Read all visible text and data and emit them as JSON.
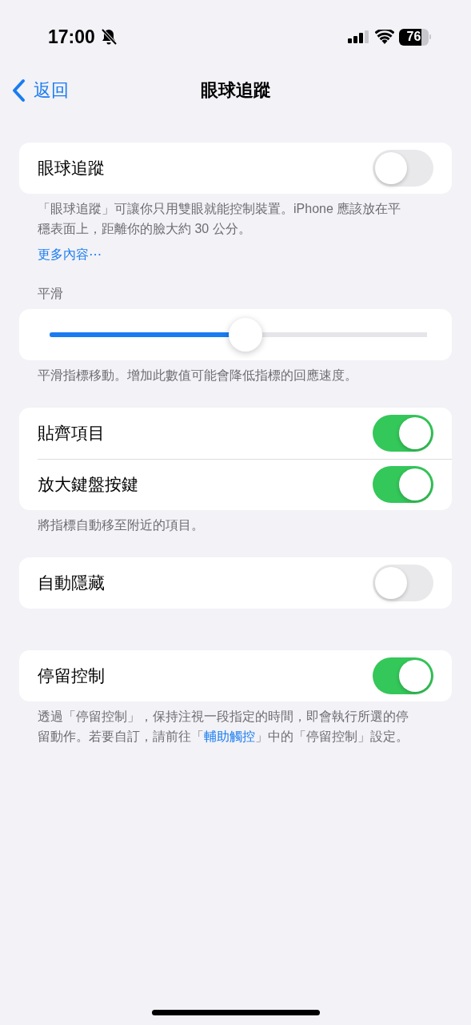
{
  "status_bar": {
    "time": "17:00",
    "silent": true,
    "battery": "76"
  },
  "nav": {
    "back": "返回",
    "title": "眼球追蹤"
  },
  "sections": [
    {
      "kind": "toggles",
      "rows": [
        {
          "label": "眼球追蹤",
          "on": false
        }
      ],
      "footer": {
        "text": "「眼球追蹤」可讓你只用雙眼就能控制裝置。iPhone 應該放在平穩表面上，距離你的臉大約 30 公分。"
      },
      "more_link": "更多內容⋯"
    },
    {
      "kind": "slider",
      "header": "平滑",
      "level": 0.52,
      "footer": {
        "text": "平滑指標移動。增加此數值可能會降低指標的回應速度。"
      }
    },
    {
      "kind": "toggles",
      "rows": [
        {
          "label": "貼齊項目",
          "on": true
        },
        {
          "label": "放大鍵盤按鍵",
          "on": true
        }
      ],
      "footer": {
        "text": "將指標自動移至附近的項目。"
      }
    },
    {
      "kind": "toggles",
      "rows": [
        {
          "label": "自動隱藏",
          "on": false
        }
      ]
    },
    {
      "kind": "toggles",
      "rows": [
        {
          "label": "停留控制",
          "on": true
        }
      ],
      "footer": {
        "text": "透過「停留控制」，保持注視一段指定的時間，即會執行所選的停留動作。若要自訂，請前往「",
        "link": "輔助觸控",
        "after": "」中的「停留控制」設定。"
      }
    }
  ]
}
